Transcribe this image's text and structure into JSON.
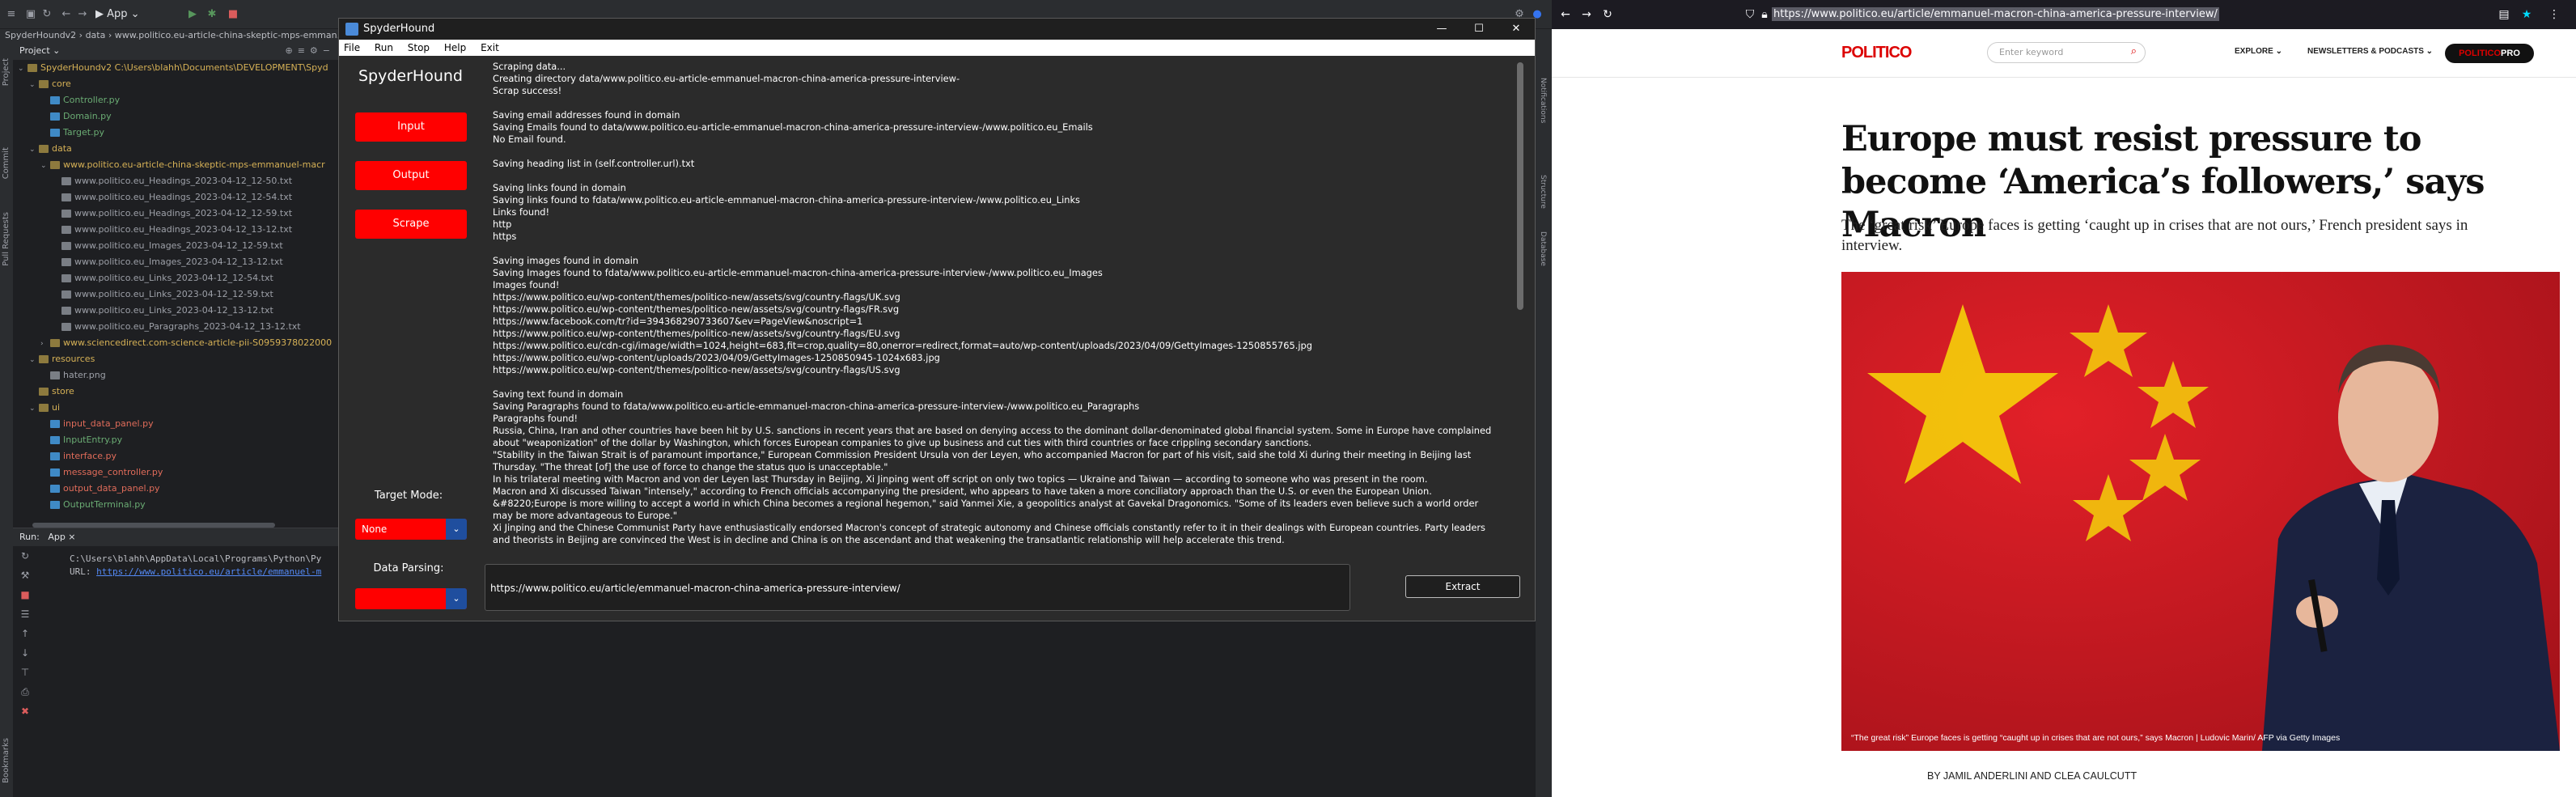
{
  "ide": {
    "project_label": "Project",
    "title": "SpyderHoundv2 › data › www.politico.eu-article-china-skeptic-mps-emman...",
    "app_tab": "App",
    "tree": [
      {
        "text": "SpyderHoundv2  C:\\Users\\blahh\\Documents\\DEVELOPMENT\\Spyd",
        "kind": "fold",
        "indent": 0,
        "glyph": "⌄"
      },
      {
        "text": "core",
        "kind": "fold",
        "indent": 1,
        "glyph": "⌄"
      },
      {
        "text": "Controller.py",
        "kind": "py",
        "indent": 2,
        "glyph": ""
      },
      {
        "text": "Domain.py",
        "kind": "py",
        "indent": 2,
        "glyph": ""
      },
      {
        "text": "Target.py",
        "kind": "py",
        "indent": 2,
        "glyph": ""
      },
      {
        "text": "data",
        "kind": "fold",
        "indent": 1,
        "glyph": "⌄"
      },
      {
        "text": "www.politico.eu-article-china-skeptic-mps-emmanuel-macr",
        "kind": "fold",
        "indent": 2,
        "glyph": "⌄"
      },
      {
        "text": "www.politico.eu_Headings_2023-04-12_12-50.txt",
        "kind": "txt",
        "indent": 3,
        "glyph": ""
      },
      {
        "text": "www.politico.eu_Headings_2023-04-12_12-54.txt",
        "kind": "txt",
        "indent": 3,
        "glyph": ""
      },
      {
        "text": "www.politico.eu_Headings_2023-04-12_12-59.txt",
        "kind": "txt",
        "indent": 3,
        "glyph": ""
      },
      {
        "text": "www.politico.eu_Headings_2023-04-12_13-12.txt",
        "kind": "txt",
        "indent": 3,
        "glyph": ""
      },
      {
        "text": "www.politico.eu_Images_2023-04-12_12-59.txt",
        "kind": "txt",
        "indent": 3,
        "glyph": ""
      },
      {
        "text": "www.politico.eu_Images_2023-04-12_13-12.txt",
        "kind": "txt",
        "indent": 3,
        "glyph": ""
      },
      {
        "text": "www.politico.eu_Links_2023-04-12_12-54.txt",
        "kind": "txt",
        "indent": 3,
        "glyph": ""
      },
      {
        "text": "www.politico.eu_Links_2023-04-12_12-59.txt",
        "kind": "txt",
        "indent": 3,
        "glyph": ""
      },
      {
        "text": "www.politico.eu_Links_2023-04-12_13-12.txt",
        "kind": "txt",
        "indent": 3,
        "glyph": ""
      },
      {
        "text": "www.politico.eu_Paragraphs_2023-04-12_13-12.txt",
        "kind": "txt",
        "indent": 3,
        "glyph": ""
      },
      {
        "text": "www.sciencedirect.com-science-article-pii-S0959378022000",
        "kind": "fold",
        "indent": 2,
        "glyph": "›"
      },
      {
        "text": "resources",
        "kind": "fold",
        "indent": 1,
        "glyph": "⌄"
      },
      {
        "text": "hater.png",
        "kind": "txt",
        "indent": 2,
        "glyph": ""
      },
      {
        "text": "store",
        "kind": "fold",
        "indent": 1,
        "glyph": ""
      },
      {
        "text": "ui",
        "kind": "fold",
        "indent": 1,
        "glyph": "⌄"
      },
      {
        "text": "input_data_panel.py",
        "kind": "red",
        "indent": 2,
        "glyph": ""
      },
      {
        "text": "InputEntry.py",
        "kind": "py",
        "indent": 2,
        "glyph": ""
      },
      {
        "text": "interface.py",
        "kind": "red",
        "indent": 2,
        "glyph": ""
      },
      {
        "text": "message_controller.py",
        "kind": "red",
        "indent": 2,
        "glyph": ""
      },
      {
        "text": "output_data_panel.py",
        "kind": "red",
        "indent": 2,
        "glyph": ""
      },
      {
        "text": "OutputTerminal.py",
        "kind": "py",
        "indent": 2,
        "glyph": ""
      }
    ],
    "run_label": "Run:",
    "run_tab": "App",
    "run_path": "C:\\Users\\blahh\\AppData\\Local\\Programs\\Python\\Py",
    "run_url_prefix": "URL:",
    "run_url": "https://www.politico.eu/article/emmanuel-m",
    "left_strip": [
      "Project",
      "Commit",
      "Pull Requests",
      "Bookmarks"
    ],
    "right_strip": [
      "Notifications",
      "Structure",
      "Database"
    ]
  },
  "app": {
    "title": "SpyderHound",
    "menu": [
      "File",
      "Run",
      "Stop",
      "Help",
      "Exit"
    ],
    "brand": "SpyderHound",
    "buttons": {
      "input": "Input",
      "output": "Output",
      "scrape": "Scrape"
    },
    "target_mode_label": "Target Mode:",
    "target_mode_value": "None",
    "data_parsing_label": "Data Parsing:",
    "data_parsing_value": "",
    "url_value": "https://www.politico.eu/article/emmanuel-macron-china-america-pressure-interview/",
    "extract_label": "Extract",
    "log": [
      "Scraping data...",
      "Creating directory data/www.politico.eu-article-emmanuel-macron-china-america-pressure-interview-",
      "Scrap success!",
      "",
      " Saving email addresses found in domain",
      "Saving Emails found to data/www.politico.eu-article-emmanuel-macron-china-america-pressure-interview-/www.politico.eu_Emails",
      "No Email found.",
      "",
      " Saving heading list in (self.controller.url).txt",
      "",
      " Saving links found in domain",
      "Saving links found to fdata/www.politico.eu-article-emmanuel-macron-china-america-pressure-interview-/www.politico.eu_Links",
      "Links found!",
      "http",
      "https",
      "",
      " Saving images found in domain",
      "Saving Images found to fdata/www.politico.eu-article-emmanuel-macron-china-america-pressure-interview-/www.politico.eu_Images",
      "Images found!",
      "https://www.politico.eu/wp-content/themes/politico-new/assets/svg/country-flags/UK.svg",
      "https://www.politico.eu/wp-content/themes/politico-new/assets/svg/country-flags/FR.svg",
      "https://www.facebook.com/tr?id=394368290733607&ev=PageView&noscript=1",
      "https://www.politico.eu/wp-content/themes/politico-new/assets/svg/country-flags/EU.svg",
      "https://www.politico.eu/cdn-cgi/image/width=1024,height=683,fit=crop,quality=80,onerror=redirect,format=auto/wp-content/uploads/2023/04/09/GettyImages-1250855765.jpg",
      "https://www.politico.eu/wp-content/uploads/2023/04/09/GettyImages-1250850945-1024x683.jpg",
      "https://www.politico.eu/wp-content/themes/politico-new/assets/svg/country-flags/US.svg",
      "",
      " Saving text found in domain",
      "Saving Paragraphs found to fdata/www.politico.eu-article-emmanuel-macron-china-america-pressure-interview-/www.politico.eu_Paragraphs",
      "Paragraphs found!",
      "Russia, China, Iran and other countries have been hit by U.S. sanctions in recent years that are based on denying access to the dominant dollar-denominated global financial system. Some in Europe have complained about \"weaponization\" of the dollar by Washington, which forces European companies to give up business and cut ties with third countries or face crippling secondary sanctions.",
      "\"Stability in the Taiwan Strait is of paramount importance,\" European Commission President Ursula von der Leyen, who accompanied Macron for part of his visit, said she told Xi during their meeting in Beijing last Thursday. \"The threat [of] the use of force to change the status quo is unacceptable.\"",
      "In his trilateral meeting with Macron and von der Leyen last Thursday in Beijing, Xi Jinping went off script on only two topics — Ukraine and Taiwan — according to someone who was present in the room.",
      "Macron and Xi discussed Taiwan \"intensely,\" according to French officials accompanying the president, who appears to have taken a more conciliatory approach than the U.S. or even the European Union.",
      "&#8220;Europe is more willing to accept a world in which China becomes a regional hegemon,\" said Yanmei Xie, a geopolitics analyst at Gavekal Dragonomics. \"Some of its leaders even believe such a world order may be more advantageous to Europe.\"",
      "Xi Jinping and the Chinese Communist Party have enthusiastically endorsed Macron's concept of strategic autonomy and Chinese officials constantly refer to it in their dealings with European countries. Party leaders and theorists in Beijing are convinced the West is in decline and China is on the ascendant and that weakening the transatlantic relationship will help accelerate this trend."
    ]
  },
  "browser": {
    "url": "https://www.politico.eu/article/emmanuel-macron-china-america-pressure-interview/",
    "logo": "POLITICO",
    "search_placeholder": "Enter keyword",
    "nav_explore": "EXPLORE",
    "nav_newsletters": "NEWSLETTERS & PODCASTS",
    "pro_left": "POLITICO",
    "pro_right": "PRO",
    "headline": "Europe must resist pressure to become ‘America’s followers,’ says Macron",
    "dek": "The ‘great risk’ Europe faces is getting ‘caught up in crises that are not ours,’ French president says in interview.",
    "caption": "“The great risk” Europe faces is getting “caught up in crises that are not ours,” says Macron | Ludovic Marin/ AFP via Getty Images",
    "byline": "BY JAMIL ANDERLINI AND CLEA CAULCUTT"
  },
  "colors": {
    "accent": "#ff0000",
    "politico_red": "#dc0000",
    "ide_bg": "#1e1f22",
    "app_bg": "#2b2b2b"
  }
}
